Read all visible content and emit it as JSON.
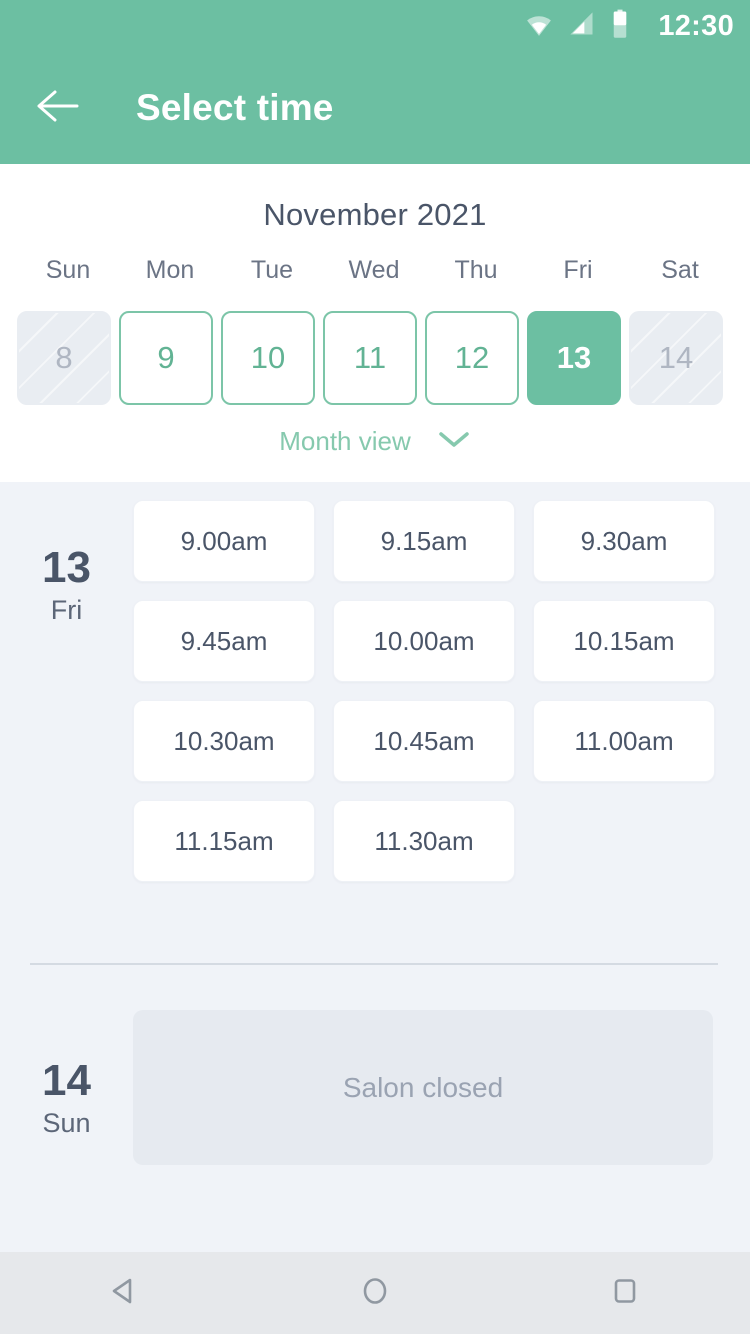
{
  "status_bar": {
    "time": "12:30",
    "icons": [
      "wifi-icon",
      "signal-icon",
      "battery-icon"
    ]
  },
  "app_bar": {
    "back_icon": "back-arrow-icon",
    "title": "Select time"
  },
  "calendar": {
    "month_title": "November 2021",
    "day_headers": [
      "Sun",
      "Mon",
      "Tue",
      "Wed",
      "Thu",
      "Fri",
      "Sat"
    ],
    "dates": [
      {
        "day": "8",
        "state": "disabled"
      },
      {
        "day": "9",
        "state": "available"
      },
      {
        "day": "10",
        "state": "available"
      },
      {
        "day": "11",
        "state": "available"
      },
      {
        "day": "12",
        "state": "available"
      },
      {
        "day": "13",
        "state": "selected"
      },
      {
        "day": "14",
        "state": "disabled"
      }
    ],
    "month_view": {
      "label": "Month view",
      "chevron_icon": "chevron-down-icon"
    }
  },
  "schedule": {
    "days": [
      {
        "date_num": "13",
        "weekday": "Fri",
        "closed": false,
        "slots": [
          "9.00am",
          "9.15am",
          "9.30am",
          "9.45am",
          "10.00am",
          "10.15am",
          "10.30am",
          "10.45am",
          "11.00am",
          "11.15am",
          "11.30am"
        ]
      },
      {
        "date_num": "14",
        "weekday": "Sun",
        "closed": true,
        "closed_message": "Salon closed",
        "slots": []
      }
    ]
  },
  "nav_bar": {
    "back_icon": "nav-back-triangle-icon",
    "home_icon": "nav-home-circle-icon",
    "recents_icon": "nav-recents-square-icon"
  },
  "colors": {
    "accent_green": "#6CBFA2",
    "accent_green_light": "#86C9AE",
    "page_background": "#F0F3F8",
    "card_white": "#FFFFFF",
    "text_dark": "#4A5568",
    "text_muted": "#9AA3B2",
    "disabled_cell": "#E9EDF2",
    "nav_background": "#E6E8EB"
  }
}
